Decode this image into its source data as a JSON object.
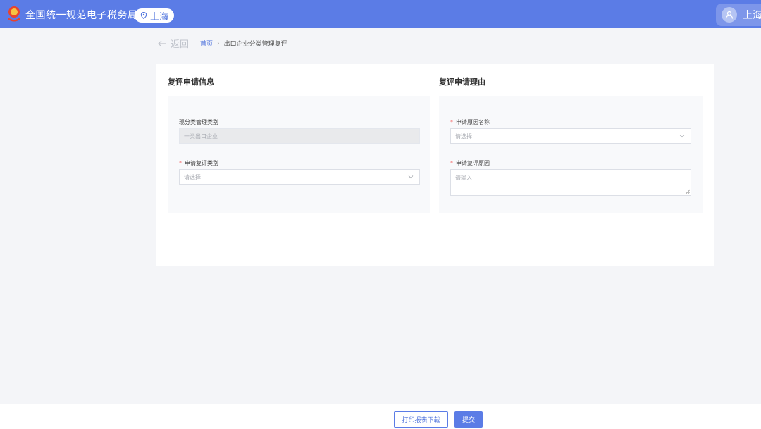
{
  "header": {
    "site_title": "全国统一规范电子税务局",
    "region": "上海",
    "user_name": "上海"
  },
  "breadcrumb": {
    "back_label": "返回",
    "home": "首页",
    "separator": "›",
    "current": "出口企业分类管理复评"
  },
  "left_section": {
    "title": "复评申请信息",
    "current_category_label": "现分类管理类别",
    "current_category_value": "一类出口企业",
    "apply_category_label": "申请复评类别",
    "apply_category_placeholder": "请选择"
  },
  "right_section": {
    "title": "复评申请理由",
    "reason_name_label": "申请原因名称",
    "reason_name_placeholder": "请选择",
    "reason_label": "申请复评原因",
    "reason_placeholder": "请输入"
  },
  "required_mark": "*",
  "footer": {
    "print_button": "打印报表下载",
    "submit_button": "提交"
  },
  "colors": {
    "brand": "#5b7ce6",
    "required": "#f56c6c",
    "page_bg": "#f4f5f8"
  },
  "icons": {
    "logo": "tax-emblem-icon",
    "region": "location-pin-icon",
    "user": "user-icon",
    "back": "arrow-left-icon",
    "select": "chevron-down-icon"
  }
}
